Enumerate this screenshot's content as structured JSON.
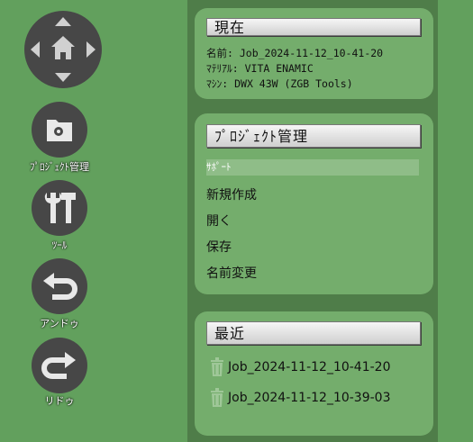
{
  "sidebar": {
    "project_label": "ﾌﾟﾛｼﾞｪｸﾄ管理",
    "tool_label": "ﾂｰﾙ",
    "undo_label": "アンドゥ",
    "redo_label": "リドゥ"
  },
  "current": {
    "title": "現在",
    "name": "名前: Job_2024-11-12_10-41-20",
    "material": "ﾏﾃﾘｱﾙ: VITA ENAMIC",
    "machine": "ﾏｼﾝ: DWX 43W (ZGB Tools)"
  },
  "project": {
    "title": "ﾌﾟﾛｼﾞｪｸﾄ管理",
    "items": [
      "ｻﾎﾟｰﾄ",
      "新規作成",
      "開く",
      "保存",
      "名前変更"
    ]
  },
  "recent": {
    "title": "最近",
    "items": [
      "Job_2024-11-12_10-41-20",
      "Job_2024-11-12_10-39-03"
    ]
  },
  "colors": {
    "background": "#5e9a58",
    "panel": "#74ad6c",
    "button": "#474747"
  }
}
